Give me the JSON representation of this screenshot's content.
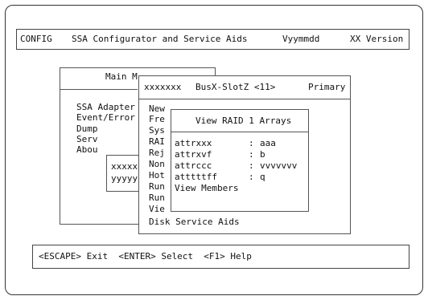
{
  "title_bar": {
    "app_code": "CONFIG",
    "app_name": "SSA Configurator and Service Aids",
    "date": "Vyymmdd",
    "version": "XX Version"
  },
  "main_menu": {
    "title": "Main M",
    "items": [
      "SSA Adapter",
      "Event/Error",
      "Dump",
      "Serv",
      "Abou"
    ],
    "sub_items": [
      "xxxxx",
      "yyyyy"
    ]
  },
  "bus_window": {
    "name": "xxxxxxx",
    "location": "BusX-SlotZ <11>",
    "status": "Primary",
    "items": [
      "New",
      "Fre",
      "Sys",
      "RAI",
      "Rej",
      "Non",
      "Hot",
      "Run",
      "Run",
      "Vie"
    ],
    "footer": "Disk Service Aids"
  },
  "raid_dialog": {
    "title": "View RAID 1 Arrays",
    "attributes": [
      {
        "name": "attrxxx",
        "sep": ":",
        "value": "aaa"
      },
      {
        "name": "attrxvf",
        "sep": ":",
        "value": "b"
      },
      {
        "name": "attrccc",
        "sep": ":",
        "value": "vvvvvvv"
      },
      {
        "name": "atttttff",
        "sep": ":",
        "value": "q"
      }
    ],
    "view_members": "View Members"
  },
  "command_bar": {
    "text": "<ESCAPE> Exit  <ENTER> Select  <F1> Help"
  }
}
